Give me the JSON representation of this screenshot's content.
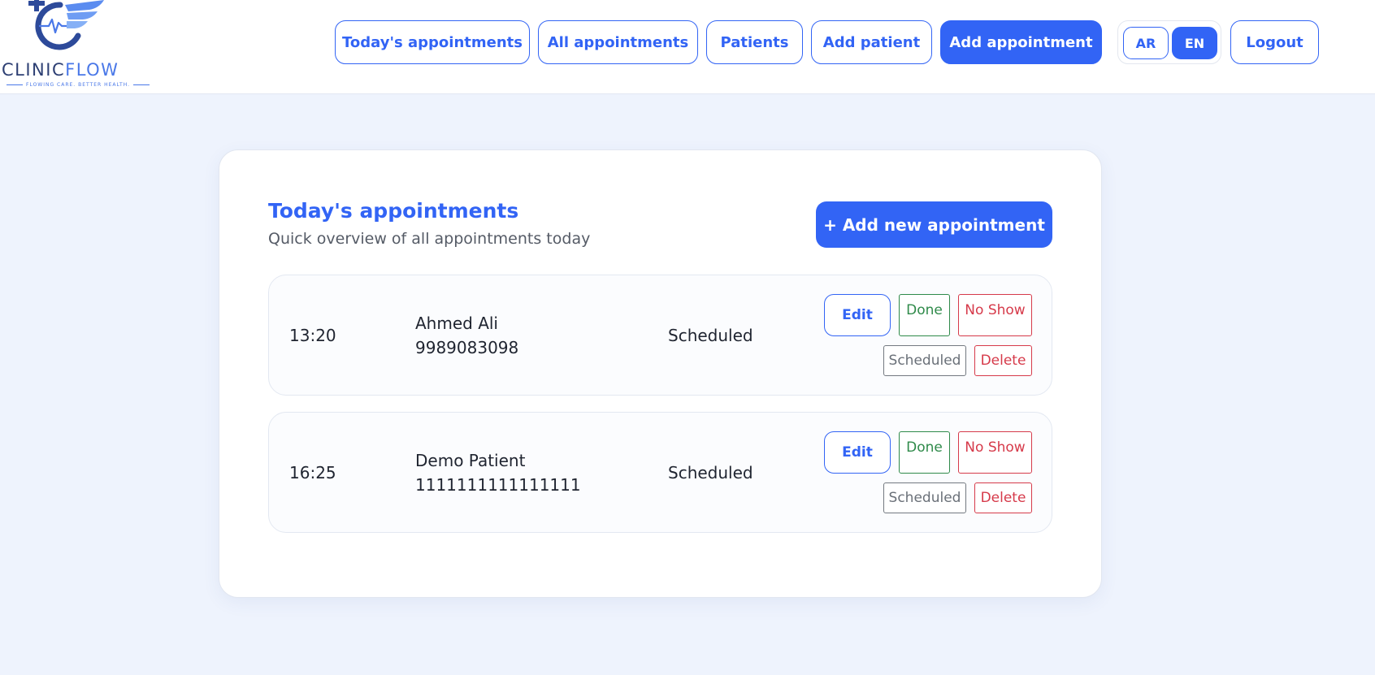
{
  "brand": {
    "name_part1": "CLINIC",
    "name_part2": "FLOW",
    "tagline": "FLOWING CARE. BETTER HEALTH."
  },
  "nav": {
    "todays_appointments": "Today's appointments",
    "all_appointments": "All appointments",
    "patients": "Patients",
    "add_patient": "Add patient",
    "add_appointment": "Add appointment",
    "active_item": "Add appointment",
    "lang_ar": "AR",
    "lang_en": "EN",
    "active_lang": "EN",
    "logout": "Logout"
  },
  "page": {
    "title": "Today's appointments",
    "subtitle": "Quick overview of all appointments today",
    "add_new_button": "+ Add new appointment"
  },
  "appointments": [
    {
      "time": "13:20",
      "patient_name": "Ahmed Ali",
      "phone": "9989083098",
      "status": "Scheduled",
      "actions": {
        "edit": "Edit",
        "done": "Done",
        "no_show": "No Show",
        "scheduled": "Scheduled",
        "delete": "Delete"
      }
    },
    {
      "time": "16:25",
      "patient_name": "Demo Patient",
      "phone": "1111111111111111",
      "status": "Scheduled",
      "actions": {
        "edit": "Edit",
        "done": "Done",
        "no_show": "No Show",
        "scheduled": "Scheduled",
        "delete": "Delete"
      }
    }
  ],
  "colors": {
    "primary": "#3264f5",
    "background": "#eef3fd",
    "success": "#2f8a4a",
    "danger": "#d63a4a",
    "neutral": "#6a7078",
    "logo_dark": "#2d3f73"
  },
  "icons": {
    "logo": "medical-cross-heartbeat-wing-logo"
  }
}
